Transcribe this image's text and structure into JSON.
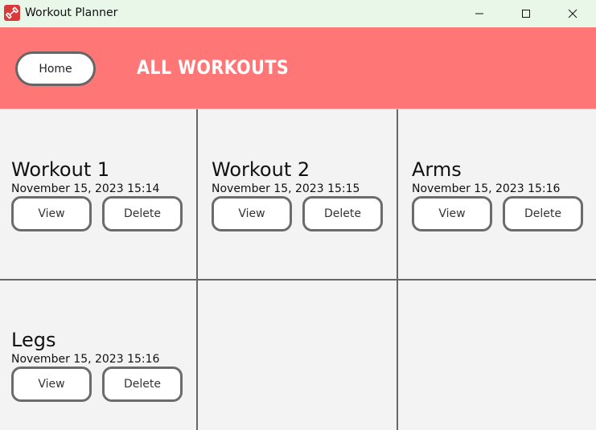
{
  "window": {
    "title": "Workout Planner",
    "icon": "dumbbell-icon",
    "controls": [
      "minimize-icon",
      "maximize-icon",
      "close-icon"
    ]
  },
  "header": {
    "home_label": "Home",
    "title": "ALL WORKOUTS",
    "background": "#ff7676"
  },
  "workouts": [
    {
      "name": "Workout 1",
      "date": "November 15, 2023 15:14",
      "view_label": "View",
      "delete_label": "Delete"
    },
    {
      "name": "Workout 2",
      "date": "November 15, 2023 15:15",
      "view_label": "View",
      "delete_label": "Delete"
    },
    {
      "name": "Arms",
      "date": "November 15, 2023 15:16",
      "view_label": "View",
      "delete_label": "Delete"
    },
    {
      "name": "Legs",
      "date": "November 15, 2023 15:16",
      "view_label": "View",
      "delete_label": "Delete"
    }
  ]
}
